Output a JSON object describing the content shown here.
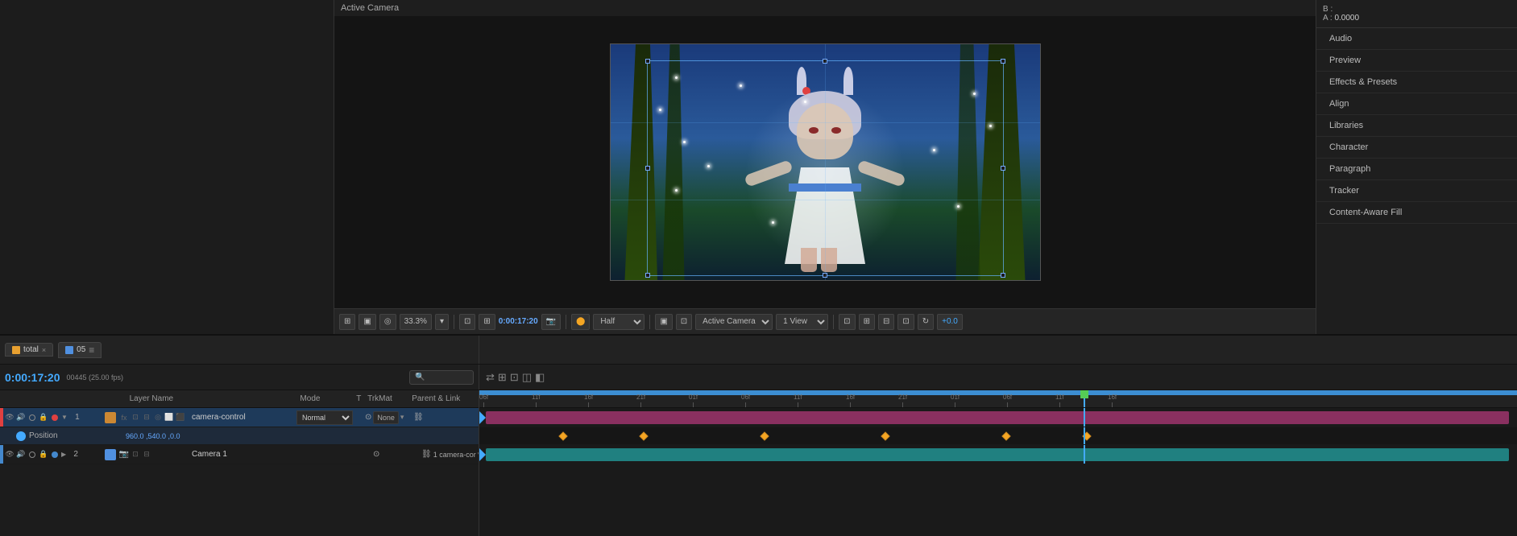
{
  "viewer": {
    "label": "Active Camera",
    "time": "0:00:17:20",
    "zoom": "33.3%",
    "resolution": "Half",
    "view": "1 View",
    "camera": "Active Camera",
    "offset": "+0.0"
  },
  "rightPanel": {
    "b_label": "B :",
    "b_value": "",
    "a_label": "A :",
    "a_value": "0.0000",
    "menu_items": [
      {
        "id": "audio",
        "label": "Audio"
      },
      {
        "id": "preview",
        "label": "Preview"
      },
      {
        "id": "effects_presets",
        "label": "Effects & Presets"
      },
      {
        "id": "align",
        "label": "Align"
      },
      {
        "id": "libraries",
        "label": "Libraries"
      },
      {
        "id": "character",
        "label": "Character"
      },
      {
        "id": "paragraph",
        "label": "Paragraph"
      },
      {
        "id": "tracker",
        "label": "Tracker"
      },
      {
        "id": "content_aware",
        "label": "Content-Aware Fill"
      }
    ]
  },
  "timeline": {
    "comp_tab": "total",
    "comp_tab2": "05",
    "time_display": "0:00:17:20",
    "fps": "00445 (25.00 fps)",
    "columns": {
      "layer_name": "Layer Name",
      "mode": "Mode",
      "t": "T",
      "trkmat": "TrkMat",
      "parent_link": "Parent & Link"
    },
    "layers": [
      {
        "id": 1,
        "color": "#e04040",
        "name": "camera-control",
        "mode": "Normal",
        "trkmat": "None",
        "parent": "",
        "has_sublayer": true,
        "sublayer_name": "Position",
        "sublayer_value": "960.0 ,540.0 ,0.0"
      },
      {
        "id": 2,
        "color": "#4488cc",
        "name": "Camera 1",
        "mode": "",
        "trkmat": "1 camera-cor",
        "parent": ""
      }
    ],
    "ruler_ticks": [
      {
        "label": "06f",
        "pos": 0
      },
      {
        "label": "11f",
        "pos": 65
      },
      {
        "label": "16f",
        "pos": 130
      },
      {
        "label": "21f",
        "pos": 195
      },
      {
        "label": "01f",
        "pos": 260
      },
      {
        "label": "06f",
        "pos": 325
      },
      {
        "label": "11f",
        "pos": 390
      },
      {
        "label": "16f",
        "pos": 455
      },
      {
        "label": "21f",
        "pos": 520
      },
      {
        "label": "01f",
        "pos": 585
      },
      {
        "label": "06f",
        "pos": 650
      },
      {
        "label": "11f",
        "pos": 715
      },
      {
        "label": "16f",
        "pos": 780
      }
    ]
  }
}
